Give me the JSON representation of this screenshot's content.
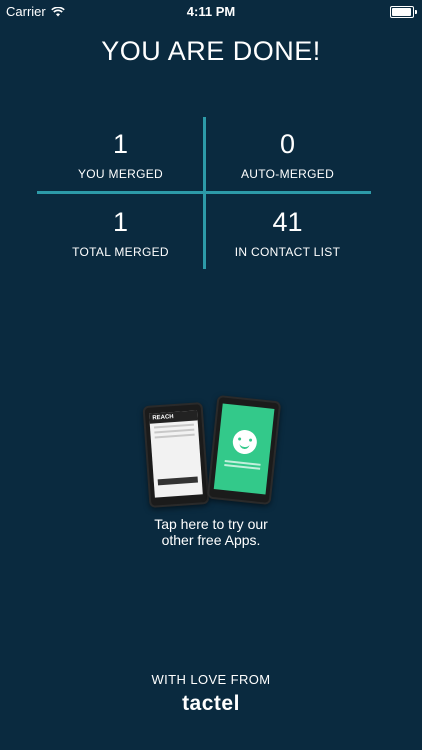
{
  "status_bar": {
    "carrier": "Carrier",
    "time": "4:11 PM",
    "icons": [
      "wifi-icon",
      "battery-icon"
    ]
  },
  "title": "YOU ARE DONE!",
  "stats": [
    {
      "value": "1",
      "label": "YOU MERGED"
    },
    {
      "value": "0",
      "label": "AUTO-MERGED"
    },
    {
      "value": "1",
      "label": "TOTAL MERGED"
    },
    {
      "value": "41",
      "label": "IN CONTACT LIST"
    }
  ],
  "promo": {
    "image_text": "REACH",
    "line1": "Tap here to try our",
    "line2": "other free Apps."
  },
  "footer": {
    "label": "WITH LOVE FROM",
    "brand": "tactel"
  },
  "colors": {
    "background": "#0a2a3f",
    "divider": "#2d9aa8",
    "promo_green": "#33c98a"
  }
}
